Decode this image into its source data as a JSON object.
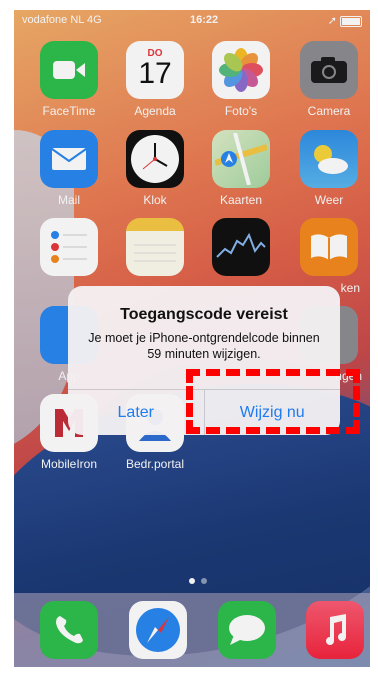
{
  "status": {
    "carrier": "vodafone NL",
    "network": "4G",
    "time": "16:22"
  },
  "apps": [
    {
      "name": "FaceTime",
      "color": "#2fbf4d"
    },
    {
      "name": "Agenda",
      "day": "DO",
      "date": "17"
    },
    {
      "name": "Foto's"
    },
    {
      "name": "Camera",
      "color": "#8d8d92"
    },
    {
      "name": "Mail",
      "color": "#2a87f0"
    },
    {
      "name": "Klok"
    },
    {
      "name": "Kaarten"
    },
    {
      "name": "Weer",
      "color": "#3c9fe9"
    },
    {
      "name": "Herinn"
    },
    {
      "name": "Notities"
    },
    {
      "name": "Aandelen"
    },
    {
      "name": "Boeken",
      "visible": "ken"
    },
    {
      "name": "App",
      "visible": "App"
    },
    {
      "name": "Instellingen",
      "visible": "ngen"
    },
    {
      "name": "MobileIron"
    },
    {
      "name": "Bedr.portal"
    }
  ],
  "dock": [
    "phone-icon",
    "safari-icon",
    "messages-icon",
    "music-icon"
  ],
  "alert": {
    "title": "Toegangscode vereist",
    "message": "Je moet je iPhone-ontgrendelcode binnen 59 minuten wijzigen.",
    "later": "Later",
    "change": "Wijzig nu"
  },
  "highlight_color": "#ff0000"
}
